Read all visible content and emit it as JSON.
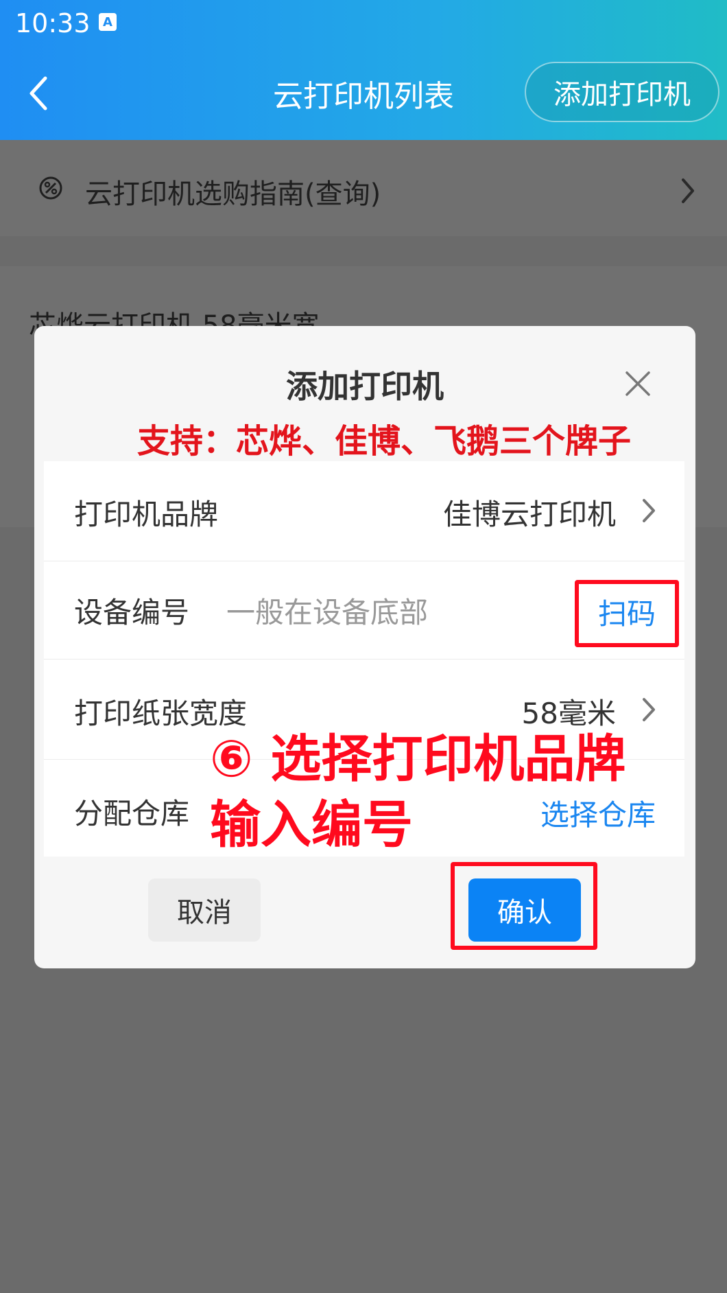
{
  "status_bar": {
    "time": "10:33",
    "icon_letter": "A"
  },
  "header": {
    "title": "云打印机列表",
    "add_button": "添加打印机"
  },
  "guide": {
    "label": "云打印机选购指南(查询)"
  },
  "background_card": {
    "text": "芯烨云打印机    58毫米宽"
  },
  "modal": {
    "title": "添加打印机",
    "support_note": "支持：芯烨、佳博、飞鹅三个牌子",
    "rows": {
      "brand": {
        "label": "打印机品牌",
        "value": "佳博云打印机"
      },
      "device": {
        "label": "设备编号",
        "placeholder": "一般在设备底部",
        "scan": "扫码"
      },
      "paper": {
        "label": "打印纸张宽度",
        "value": "58毫米"
      },
      "warehouse": {
        "label": "分配仓库",
        "action": "选择仓库"
      }
    },
    "cancel": "取消",
    "confirm": "确认"
  },
  "annotation": {
    "line1": "⑥ 选择打印机品牌",
    "line2": "输入编号"
  },
  "colors": {
    "accent": "#0b83f5",
    "annotation": "#ff0a1e",
    "link": "#1a86f0"
  }
}
